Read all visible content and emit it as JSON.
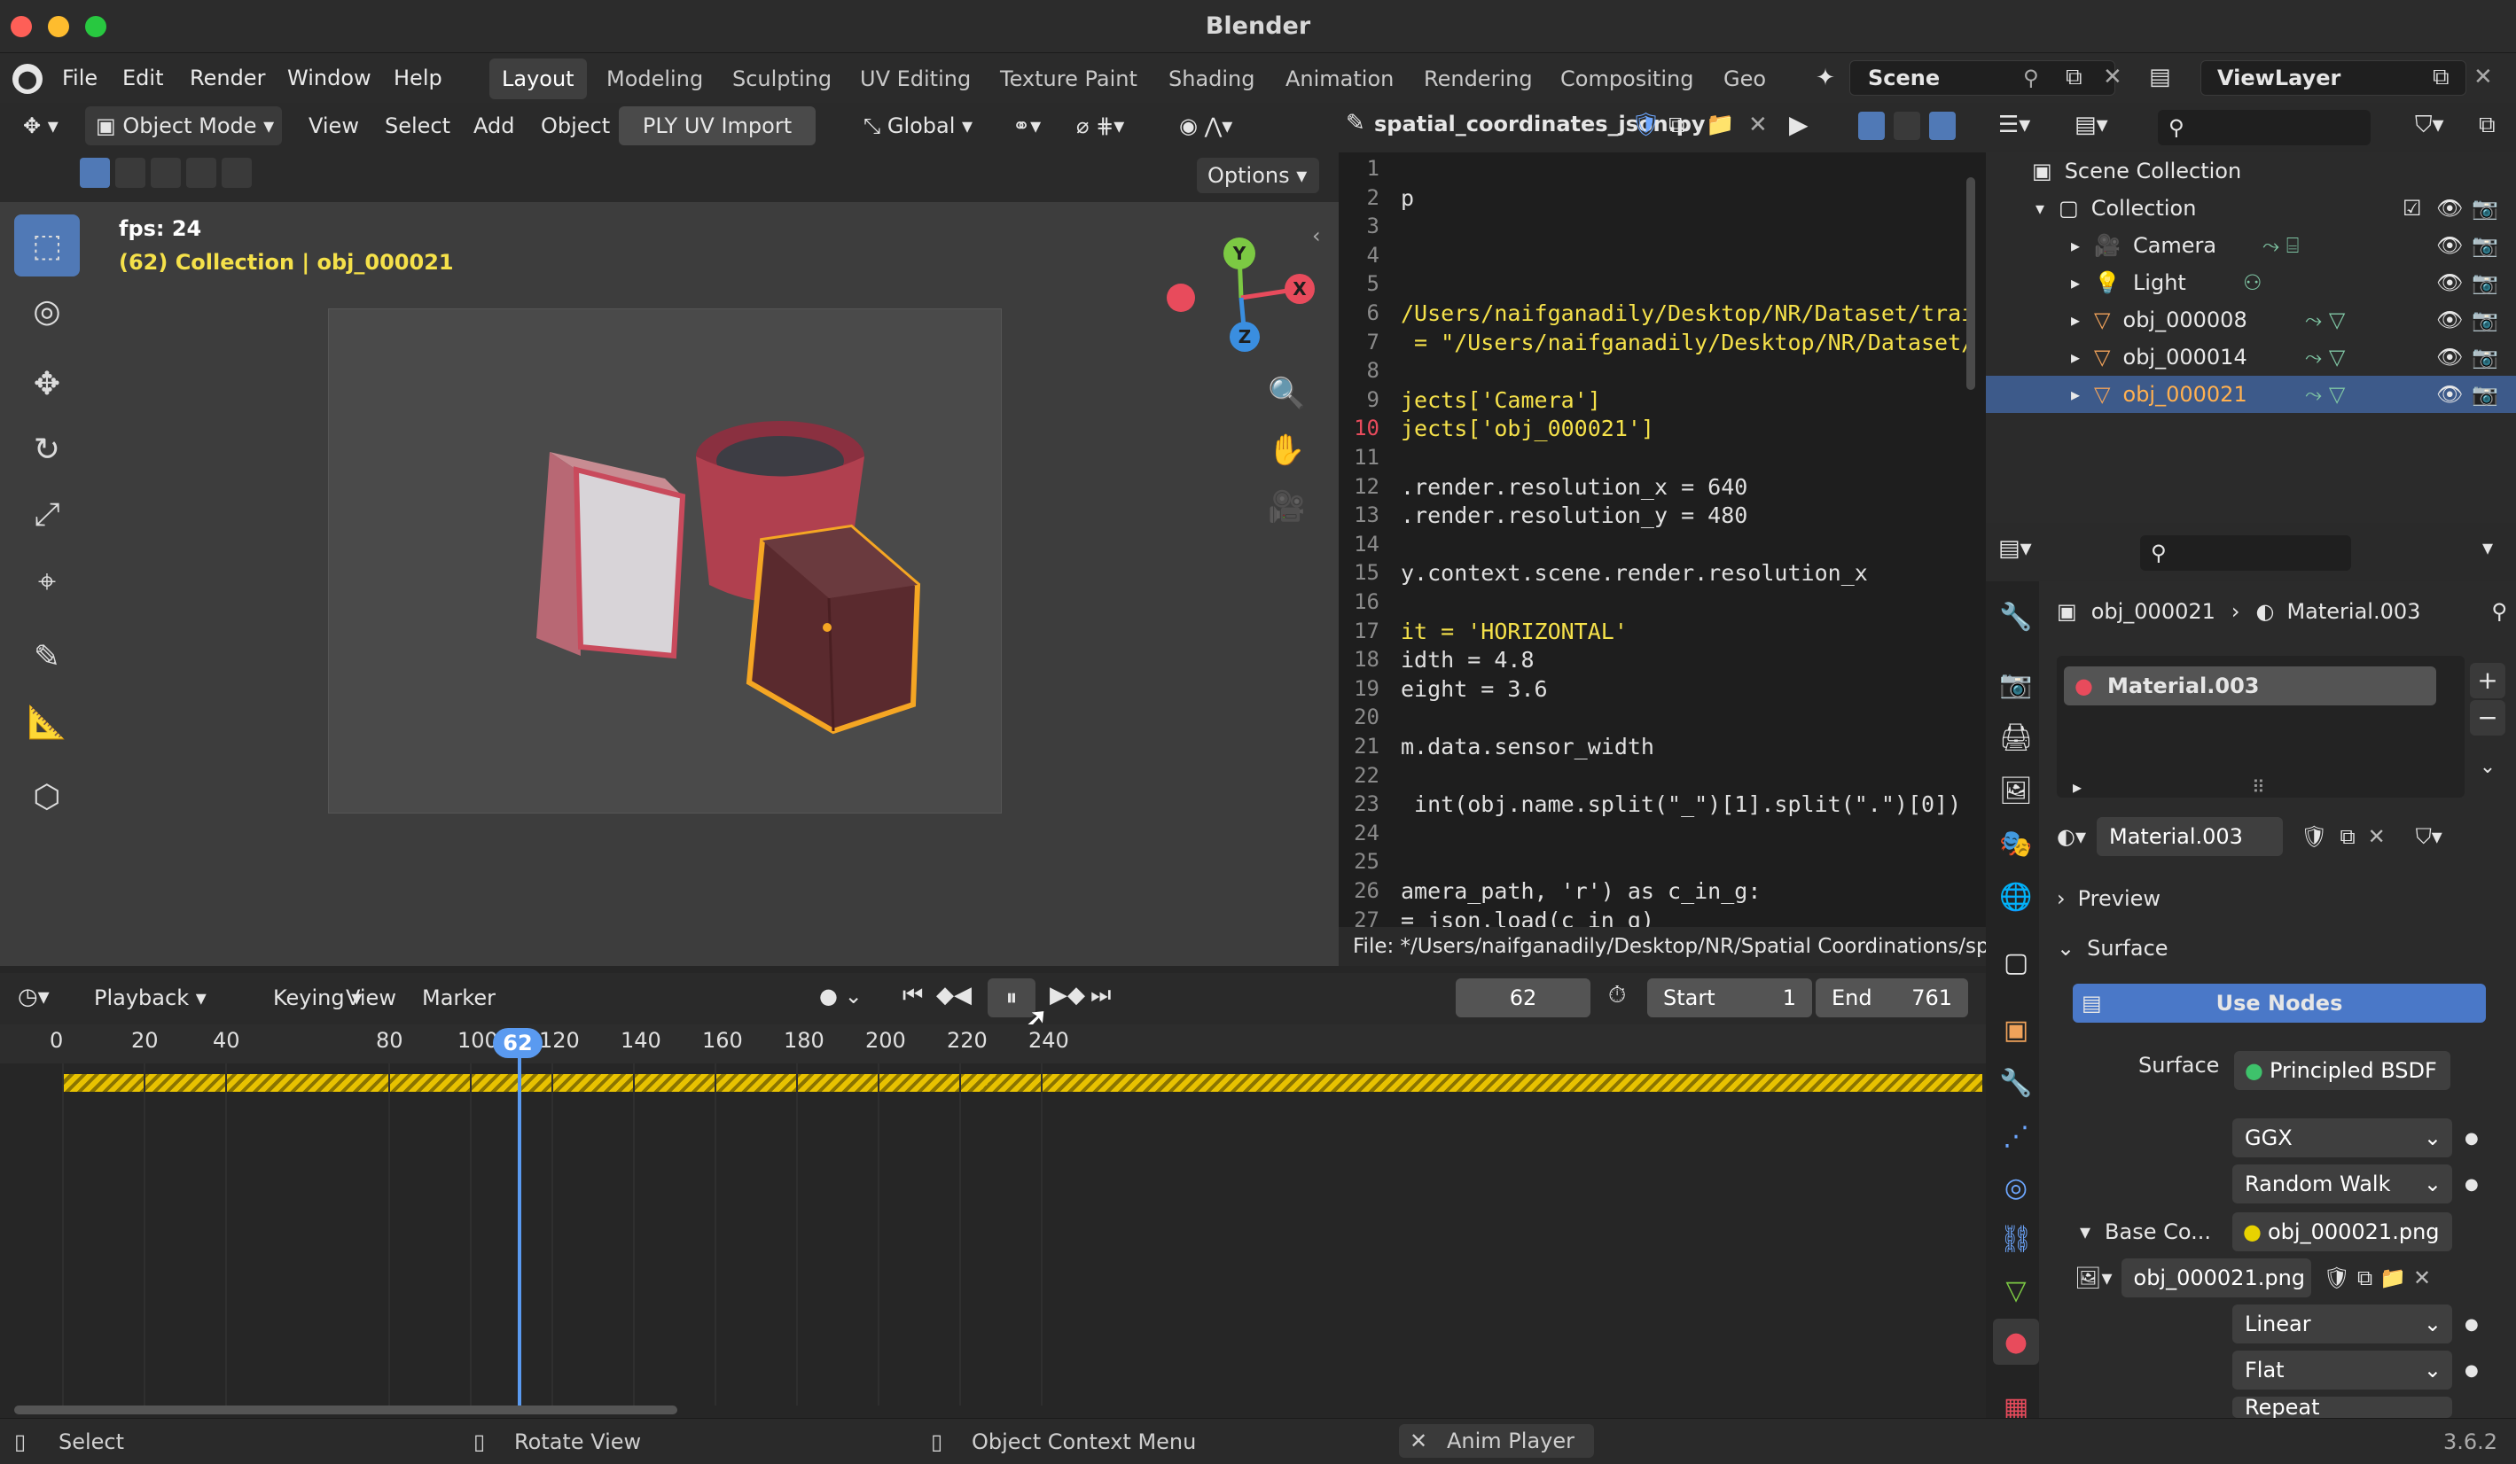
{
  "window": {
    "title": "Blender"
  },
  "menu": {
    "items": [
      "File",
      "Edit",
      "Render",
      "Window",
      "Help"
    ]
  },
  "workspaces": [
    "Layout",
    "Modeling",
    "Sculpting",
    "UV Editing",
    "Texture Paint",
    "Shading",
    "Animation",
    "Rendering",
    "Compositing",
    "Geo"
  ],
  "scene": {
    "name": "Scene",
    "view_layer": "ViewLayer"
  },
  "viewport": {
    "mode": "Object Mode",
    "menu": [
      "View",
      "Select",
      "Add",
      "Object"
    ],
    "ply_button": "PLY UV Import",
    "transform": "Global",
    "options": "Options",
    "fps": "fps: 24",
    "collection_info": "(62) Collection | obj_000021",
    "gizmo": {
      "y": "Y",
      "x": "X",
      "z": "Z"
    }
  },
  "text_editor": {
    "filename": "spatial_coordinates_json.py",
    "lines": [
      {
        "n": "1",
        "text": ""
      },
      {
        "n": "2",
        "text": "p"
      },
      {
        "n": "3",
        "text": ""
      },
      {
        "n": "4",
        "text": ""
      },
      {
        "n": "5",
        "text": ""
      },
      {
        "n": "6",
        "text": "/Users/naifganadily/Desktop/NR/Dataset/trai"
      },
      {
        "n": "7",
        "text": " = \"/Users/naifganadily/Desktop/NR/Dataset/"
      },
      {
        "n": "8",
        "text": ""
      },
      {
        "n": "9",
        "text": "jects['Camera']"
      },
      {
        "n": "10",
        "text": "jects['obj_000021']"
      },
      {
        "n": "11",
        "text": ""
      },
      {
        "n": "12",
        "text": ".render.resolution_x = 640"
      },
      {
        "n": "13",
        "text": ".render.resolution_y = 480"
      },
      {
        "n": "14",
        "text": ""
      },
      {
        "n": "15",
        "text": "y.context.scene.render.resolution_x"
      },
      {
        "n": "16",
        "text": ""
      },
      {
        "n": "17",
        "text": "it = 'HORIZONTAL'"
      },
      {
        "n": "18",
        "text": "idth = 4.8"
      },
      {
        "n": "19",
        "text": "eight = 3.6"
      },
      {
        "n": "20",
        "text": ""
      },
      {
        "n": "21",
        "text": "m.data.sensor_width"
      },
      {
        "n": "22",
        "text": ""
      },
      {
        "n": "23",
        "text": " int(obj.name.split(\"_\")[1].split(\".\")[0])"
      },
      {
        "n": "24",
        "text": ""
      },
      {
        "n": "25",
        "text": ""
      },
      {
        "n": "26",
        "text": "amera_path, 'r') as c_in_g:"
      },
      {
        "n": "27",
        "text": "= json.load(c_in_g)"
      }
    ],
    "status": "File: */Users/naifganadily/Desktop/NR/Spatial Coordinations/spa"
  },
  "outliner": {
    "root": "Scene Collection",
    "collection": "Collection",
    "items": [
      "Camera",
      "Light",
      "obj_000008",
      "obj_000014",
      "obj_000021"
    ],
    "selected": "obj_000021"
  },
  "properties": {
    "breadcrumb_obj": "obj_000021",
    "breadcrumb_mat": "Material.003",
    "slot": "Material.003",
    "material": "Material.003",
    "preview": "Preview",
    "surface_panel": "Surface",
    "use_nodes": "Use Nodes",
    "surface_label": "Surface",
    "surface_value": "Principled BSDF",
    "distribution": "GGX",
    "subsurface": "Random Walk",
    "base_color_label": "Base Co...",
    "base_color_value": "obj_000021.png",
    "image": "obj_000021.png",
    "interpolation": "Linear",
    "projection": "Flat",
    "extension": "Repeat"
  },
  "timeline": {
    "menu": [
      "Playback",
      "Keying",
      "View",
      "Marker"
    ],
    "current_frame": "62",
    "start_label": "Start",
    "start": "1",
    "end_label": "End",
    "end": "761",
    "ticks": [
      "0",
      "20",
      "40",
      "80",
      "100",
      "120",
      "140",
      "160",
      "180",
      "200",
      "220",
      "240"
    ],
    "playhead_label": "62"
  },
  "statusbar": {
    "select": "Select",
    "rotate": "Rotate View",
    "context": "Object Context Menu",
    "anim": "Anim Player",
    "version": "3.6.2"
  },
  "colors": {
    "accent": "#5079b6",
    "selection_orange": "#f5a623",
    "keyframe_yellow": "#e8c200"
  }
}
